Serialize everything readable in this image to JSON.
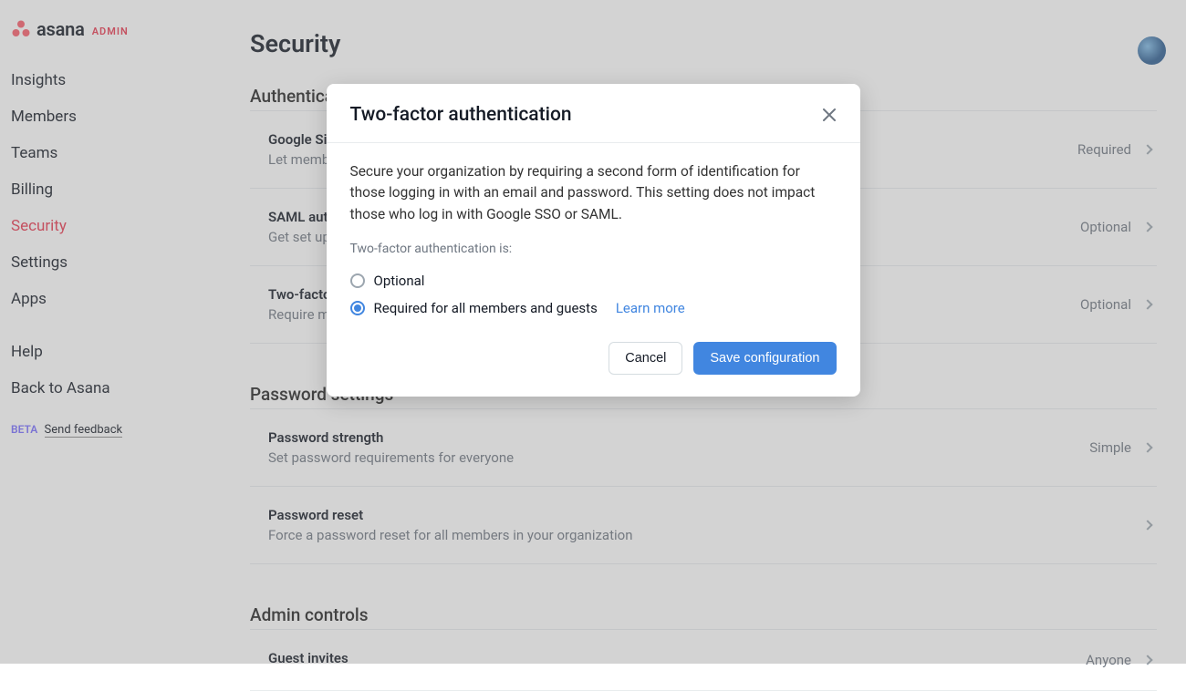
{
  "brand": {
    "word": "asana",
    "admin_label": "ADMIN"
  },
  "sidebar": {
    "items": [
      {
        "label": "Insights"
      },
      {
        "label": "Members"
      },
      {
        "label": "Teams"
      },
      {
        "label": "Billing"
      },
      {
        "label": "Security"
      },
      {
        "label": "Settings"
      },
      {
        "label": "Apps"
      }
    ],
    "secondary": [
      {
        "label": "Help"
      },
      {
        "label": "Back to Asana"
      }
    ],
    "beta_label": "BETA",
    "feedback_link": "Send feedback"
  },
  "page": {
    "title": "Security"
  },
  "sections": {
    "authentication": {
      "heading": "Authentication",
      "rows": [
        {
          "title": "Google Sign-in",
          "desc": "Let members log in with their Google account",
          "value": "Required"
        },
        {
          "title": "SAML authentication",
          "desc": "Get set up with a SAML-based identity provider",
          "value": "Optional"
        },
        {
          "title": "Two-factor authentication",
          "desc": "Require members to use a second form of identification",
          "value": "Optional"
        }
      ]
    },
    "password": {
      "heading": "Password settings",
      "rows": [
        {
          "title": "Password strength",
          "desc": "Set password requirements for everyone",
          "value": "Simple"
        },
        {
          "title": "Password reset",
          "desc": "Force a password reset for all members in your organization",
          "value": ""
        }
      ]
    },
    "admin": {
      "heading": "Admin controls",
      "rows": [
        {
          "title": "Guest invites",
          "desc": "",
          "value": "Anyone"
        }
      ]
    }
  },
  "modal": {
    "title": "Two-factor authentication",
    "description": "Secure your organization by requiring a second form of identification for those logging in with an email and password. This setting does not impact those who log in with Google SSO or SAML.",
    "subheading": "Two-factor authentication is:",
    "option_optional": "Optional",
    "option_required": "Required for all members and guests",
    "learn_more": "Learn more",
    "cancel": "Cancel",
    "save": "Save configuration"
  }
}
